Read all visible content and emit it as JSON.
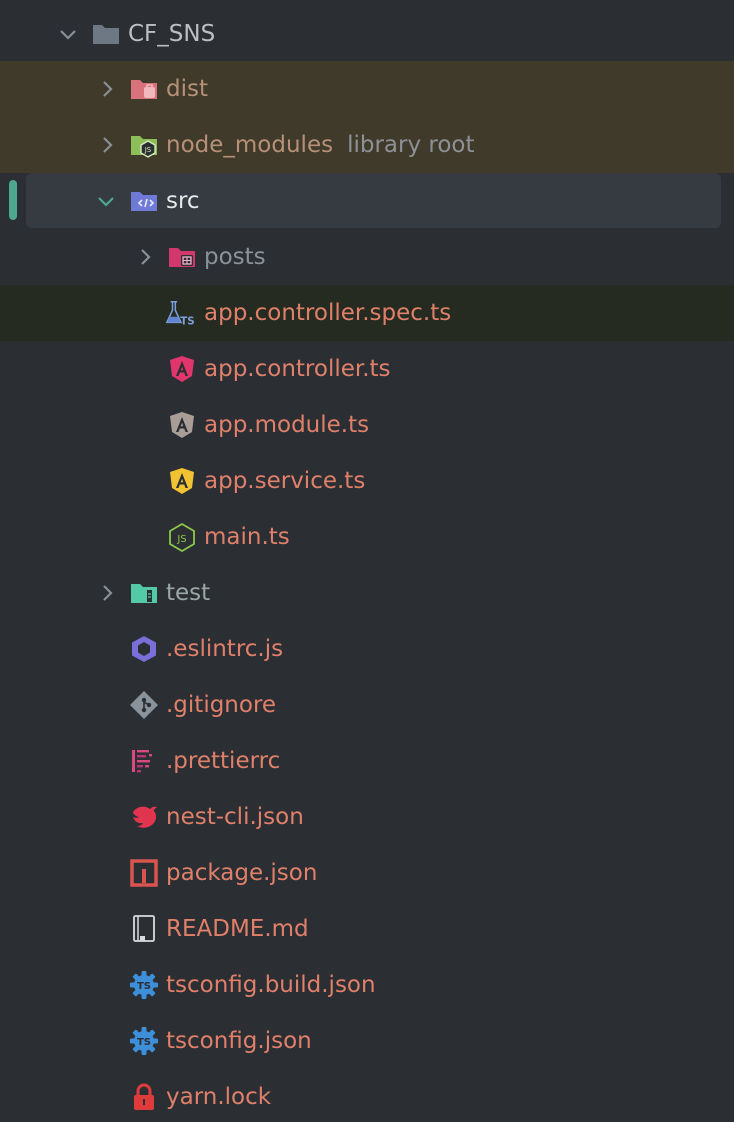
{
  "tree": {
    "root": {
      "label": "CF_SNS"
    },
    "dist": {
      "label": "dist"
    },
    "node_modules": {
      "label": "node_modules",
      "hint": "library root"
    },
    "src": {
      "label": "src"
    },
    "posts": {
      "label": "posts"
    },
    "files_src": [
      {
        "label": "app.controller.spec.ts",
        "icon": "test-flask-ts-icon"
      },
      {
        "label": "app.controller.ts",
        "icon": "angular-controller-icon"
      },
      {
        "label": "app.module.ts",
        "icon": "angular-module-icon"
      },
      {
        "label": "app.service.ts",
        "icon": "angular-service-icon"
      },
      {
        "label": "main.ts",
        "icon": "nodejs-icon"
      }
    ],
    "test": {
      "label": "test"
    },
    "files_root": [
      {
        "label": ".eslintrc.js",
        "icon": "eslint-icon"
      },
      {
        "label": ".gitignore",
        "icon": "git-icon"
      },
      {
        "label": ".prettierrc",
        "icon": "prettier-icon"
      },
      {
        "label": "nest-cli.json",
        "icon": "nestjs-icon"
      },
      {
        "label": "package.json",
        "icon": "npm-icon"
      },
      {
        "label": "README.md",
        "icon": "readme-book-icon"
      },
      {
        "label": "tsconfig.build.json",
        "icon": "tsconfig-gear-icon"
      },
      {
        "label": "tsconfig.json",
        "icon": "tsconfig-gear-icon"
      },
      {
        "label": "yarn.lock",
        "icon": "lock-icon"
      }
    ]
  },
  "colors": {
    "background": "#2b2e33",
    "ignored_row": "#403a2a",
    "selected_row": "#353b41",
    "accent": "#4ea88e",
    "file_text": "#e0806a"
  }
}
